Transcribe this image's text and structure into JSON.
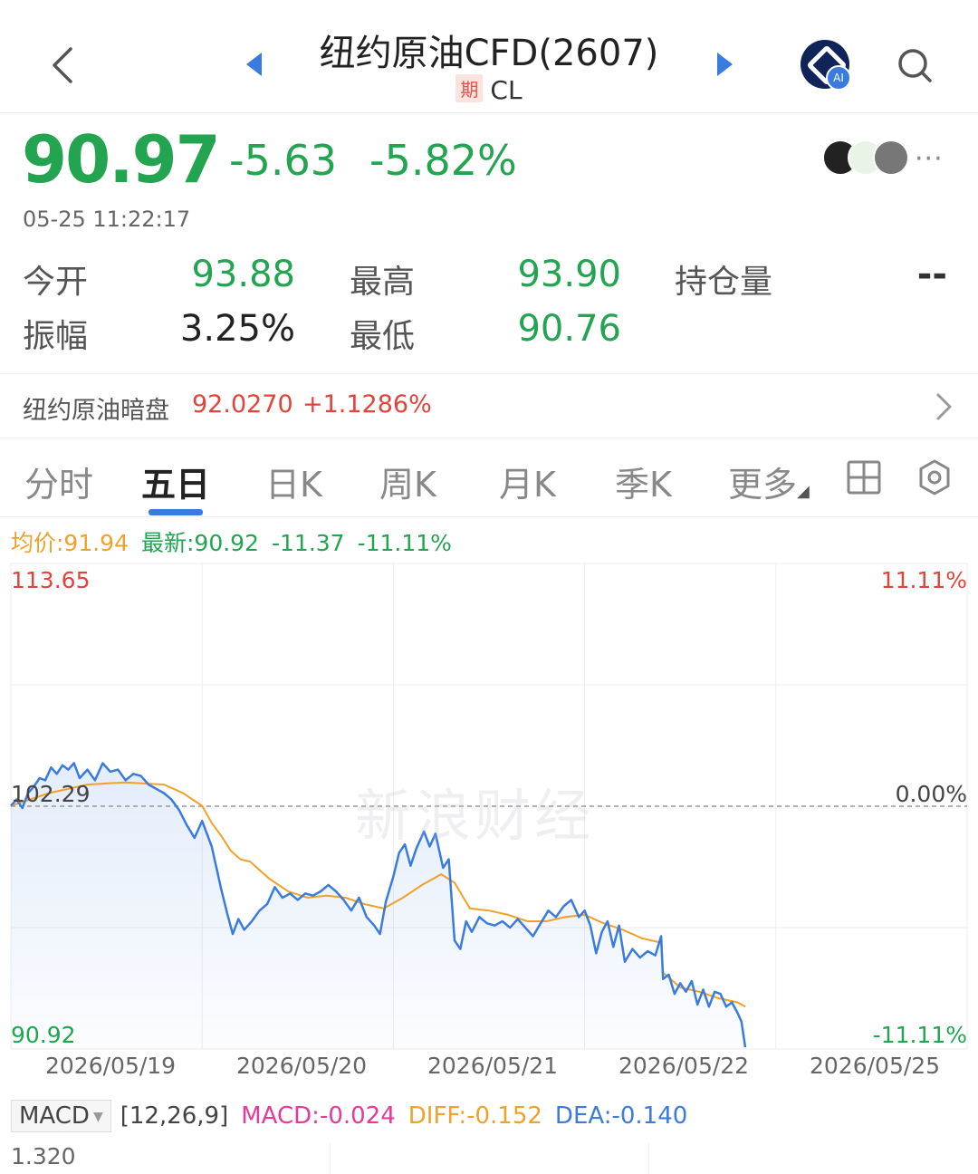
{
  "header": {
    "title": "纽约原油CFD(2607)",
    "badge": "期",
    "code": "CL",
    "ai_tag": "AI"
  },
  "quote": {
    "price": "90.97",
    "change": "-5.63",
    "change_pct": "-5.82%",
    "timestamp": "05-25 11:22:17",
    "more": "···"
  },
  "stats": {
    "open_label": "今开",
    "open": "93.88",
    "high_label": "最高",
    "high": "93.90",
    "oi_label": "持仓量",
    "oi": "--",
    "amp_label": "振幅",
    "amp": "3.25%",
    "low_label": "最低",
    "low": "90.76"
  },
  "dark_pool": {
    "label": "纽约原油暗盘",
    "price": "92.0270",
    "change_pct": "+1.1286%"
  },
  "tabs": [
    "分时",
    "五日",
    "日K",
    "周K",
    "月K",
    "季K",
    "更多"
  ],
  "active_tab": "五日",
  "chart_stats": {
    "avg": "均价:91.94",
    "latest": "最新:90.92",
    "change": "-11.37",
    "change_pct": "-11.11%"
  },
  "chart_data": {
    "type": "line",
    "title": "",
    "x": [
      "2026/05/19",
      "2026/05/20",
      "2026/05/21",
      "2026/05/22",
      "2026/05/25"
    ],
    "y_left_top": "113.65",
    "y_left_mid": "102.29",
    "y_left_bottom": "90.92",
    "y_right_top": "11.11%",
    "y_right_mid": "0.00%",
    "y_right_bottom": "-11.11%",
    "ylim": [
      90.92,
      113.65
    ],
    "series": [
      {
        "name": "",
        "color": "#3a7be0",
        "points": [
          [
            0.0,
            102.3
          ],
          [
            0.03,
            102.6
          ],
          [
            0.06,
            102.2
          ],
          [
            0.09,
            102.9
          ],
          [
            0.12,
            103.2
          ],
          [
            0.15,
            103.6
          ],
          [
            0.18,
            103.5
          ],
          [
            0.21,
            104.1
          ],
          [
            0.24,
            103.8
          ],
          [
            0.27,
            104.2
          ],
          [
            0.3,
            104.0
          ],
          [
            0.33,
            104.3
          ],
          [
            0.36,
            103.6
          ],
          [
            0.4,
            104.0
          ],
          [
            0.44,
            103.5
          ],
          [
            0.48,
            104.3
          ],
          [
            0.52,
            103.9
          ],
          [
            0.56,
            104.0
          ],
          [
            0.6,
            103.5
          ],
          [
            0.64,
            103.8
          ],
          [
            0.68,
            103.7
          ],
          [
            0.72,
            103.3
          ],
          [
            0.76,
            103.1
          ],
          [
            0.8,
            102.9
          ],
          [
            0.84,
            102.6
          ],
          [
            0.88,
            102.1
          ],
          [
            0.92,
            101.4
          ],
          [
            0.96,
            100.8
          ],
          [
            1.0,
            101.6
          ],
          [
            1.05,
            100.4
          ],
          [
            1.1,
            98.4
          ],
          [
            1.13,
            97.3
          ],
          [
            1.16,
            96.3
          ],
          [
            1.19,
            97.0
          ],
          [
            1.22,
            96.5
          ],
          [
            1.26,
            96.9
          ],
          [
            1.3,
            97.4
          ],
          [
            1.34,
            97.7
          ],
          [
            1.38,
            98.5
          ],
          [
            1.42,
            98.0
          ],
          [
            1.46,
            98.2
          ],
          [
            1.5,
            97.9
          ],
          [
            1.54,
            98.2
          ],
          [
            1.58,
            98.1
          ],
          [
            1.62,
            98.3
          ],
          [
            1.66,
            98.6
          ],
          [
            1.7,
            98.3
          ],
          [
            1.74,
            97.9
          ],
          [
            1.78,
            97.4
          ],
          [
            1.82,
            98.0
          ],
          [
            1.86,
            97.1
          ],
          [
            1.9,
            96.7
          ],
          [
            1.93,
            96.3
          ],
          [
            1.96,
            97.8
          ],
          [
            2.0,
            99.0
          ],
          [
            2.03,
            100.1
          ],
          [
            2.06,
            100.5
          ],
          [
            2.09,
            99.5
          ],
          [
            2.12,
            100.3
          ],
          [
            2.16,
            101.1
          ],
          [
            2.19,
            100.4
          ],
          [
            2.22,
            101.0
          ],
          [
            2.26,
            99.4
          ],
          [
            2.29,
            99.8
          ],
          [
            2.32,
            96.0
          ],
          [
            2.35,
            95.6
          ],
          [
            2.38,
            96.9
          ],
          [
            2.41,
            96.4
          ],
          [
            2.45,
            97.1
          ],
          [
            2.49,
            96.8
          ],
          [
            2.53,
            96.7
          ],
          [
            2.57,
            96.9
          ],
          [
            2.61,
            96.6
          ],
          [
            2.65,
            97.0
          ],
          [
            2.69,
            96.6
          ],
          [
            2.73,
            96.2
          ],
          [
            2.77,
            96.8
          ],
          [
            2.81,
            97.4
          ],
          [
            2.85,
            97.1
          ],
          [
            2.89,
            97.6
          ],
          [
            2.93,
            97.9
          ],
          [
            2.97,
            97.1
          ],
          [
            3.0,
            97.4
          ],
          [
            3.03,
            96.7
          ],
          [
            3.06,
            95.4
          ],
          [
            3.09,
            96.4
          ],
          [
            3.12,
            96.9
          ],
          [
            3.15,
            95.7
          ],
          [
            3.18,
            96.7
          ],
          [
            3.21,
            95.0
          ],
          [
            3.25,
            95.6
          ],
          [
            3.29,
            95.2
          ],
          [
            3.33,
            95.5
          ],
          [
            3.37,
            95.3
          ],
          [
            3.4,
            96.2
          ],
          [
            3.41,
            94.2
          ],
          [
            3.44,
            94.4
          ],
          [
            3.47,
            93.5
          ],
          [
            3.5,
            94.0
          ],
          [
            3.53,
            93.6
          ],
          [
            3.56,
            94.1
          ],
          [
            3.59,
            93.0
          ],
          [
            3.62,
            93.7
          ],
          [
            3.65,
            92.9
          ],
          [
            3.68,
            93.6
          ],
          [
            3.71,
            93.5
          ],
          [
            3.74,
            92.9
          ],
          [
            3.77,
            93.1
          ],
          [
            3.8,
            92.6
          ],
          [
            3.82,
            92.2
          ],
          [
            3.84,
            91.0
          ]
        ]
      },
      {
        "name": "均价",
        "color": "#f0a12a",
        "points": [
          [
            0.0,
            102.3
          ],
          [
            0.2,
            102.9
          ],
          [
            0.4,
            103.3
          ],
          [
            0.6,
            103.4
          ],
          [
            0.8,
            103.3
          ],
          [
            0.9,
            102.9
          ],
          [
            1.0,
            102.3
          ],
          [
            1.05,
            101.5
          ],
          [
            1.1,
            100.9
          ],
          [
            1.15,
            100.2
          ],
          [
            1.2,
            99.8
          ],
          [
            1.25,
            99.7
          ],
          [
            1.35,
            98.9
          ],
          [
            1.45,
            98.3
          ],
          [
            1.55,
            98.0
          ],
          [
            1.65,
            98.1
          ],
          [
            1.75,
            98.0
          ],
          [
            1.85,
            97.7
          ],
          [
            1.95,
            97.5
          ],
          [
            2.05,
            98.0
          ],
          [
            2.15,
            98.6
          ],
          [
            2.25,
            99.1
          ],
          [
            2.32,
            98.7
          ],
          [
            2.4,
            97.5
          ],
          [
            2.5,
            97.4
          ],
          [
            2.6,
            97.2
          ],
          [
            2.7,
            96.9
          ],
          [
            2.8,
            96.9
          ],
          [
            2.9,
            97.1
          ],
          [
            3.0,
            97.2
          ],
          [
            3.1,
            96.8
          ],
          [
            3.2,
            96.5
          ],
          [
            3.3,
            96.1
          ],
          [
            3.4,
            95.9
          ],
          [
            3.41,
            94.5
          ],
          [
            3.5,
            93.8
          ],
          [
            3.6,
            93.6
          ],
          [
            3.7,
            93.3
          ],
          [
            3.8,
            93.1
          ],
          [
            3.84,
            92.9
          ]
        ]
      }
    ]
  },
  "macd": {
    "selector": "MACD",
    "params": "[12,26,9]",
    "macd": "MACD:-0.024",
    "diff": "DIFF:-0.152",
    "dea": "DEA:-0.140",
    "top_value": "1.320"
  },
  "watermark": "新浪财经",
  "colors": {
    "up": "#e0443a",
    "down": "#23a450",
    "accent": "#3a7be0",
    "avg_line": "#f0a12a",
    "macd": "#e6399b",
    "diff": "#f0a12a",
    "dea": "#3a7be0"
  }
}
